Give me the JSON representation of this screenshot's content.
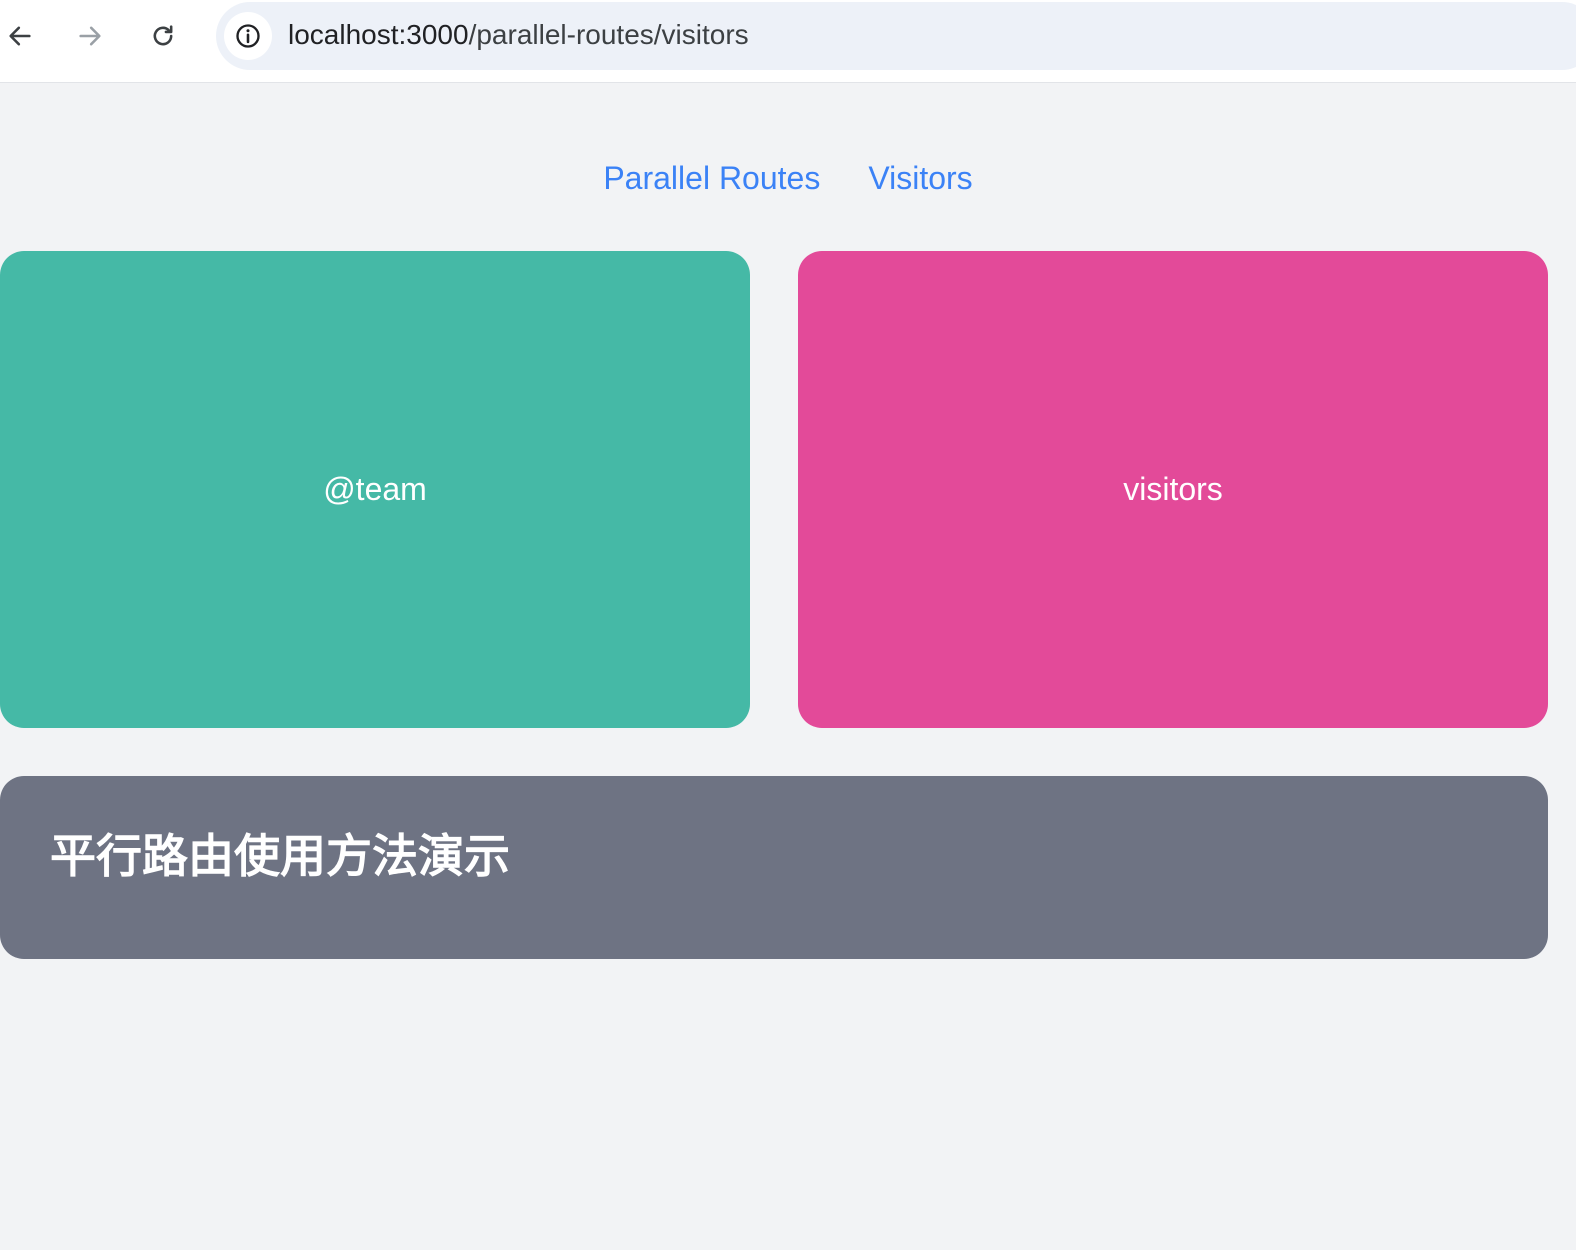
{
  "browser": {
    "url_host": "localhost:3000",
    "url_path": "/parallel-routes/visitors",
    "icons": {
      "back": "back-arrow-icon",
      "forward": "forward-arrow-icon",
      "reload": "reload-icon",
      "info": "info-icon"
    }
  },
  "nav": {
    "links": [
      {
        "label": "Parallel Routes"
      },
      {
        "label": "Visitors"
      }
    ],
    "link_color": "#3b82f6"
  },
  "panels": {
    "team": {
      "label": "@team",
      "color": "#45b9a6"
    },
    "visitors": {
      "label": "visitors",
      "color": "#e34a99"
    }
  },
  "footer": {
    "title": "平行路由使用方法演示",
    "color": "#6e7383"
  },
  "page_background": "#f2f3f5"
}
